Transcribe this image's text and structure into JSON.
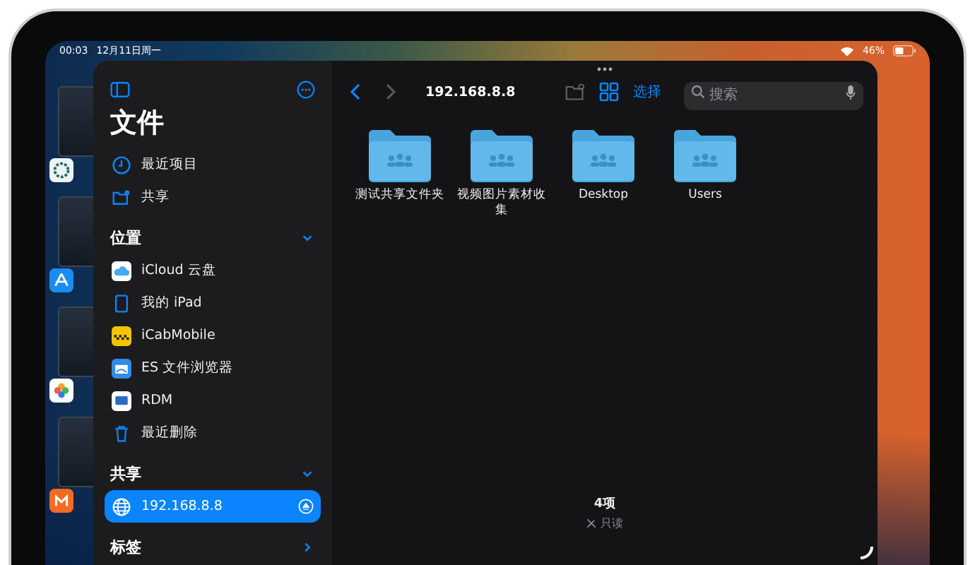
{
  "status_bar": {
    "time": "00:03",
    "date": "12月11日周一",
    "battery": "46%"
  },
  "sidebar": {
    "title": "文件",
    "items": [
      {
        "label": "最近项目",
        "kind": "clock",
        "selected": false
      },
      {
        "label": "共享",
        "kind": "shared",
        "selected": false
      }
    ],
    "sections": [
      {
        "title": "位置",
        "expanded": true,
        "items": [
          {
            "label": "iCloud 云盘",
            "kind": "cloud",
            "selected": false
          },
          {
            "label": "我的 iPad",
            "kind": "device",
            "selected": false
          },
          {
            "label": "iCabMobile",
            "kind": "cab",
            "selected": false
          },
          {
            "label": "ES 文件浏览器",
            "kind": "es",
            "selected": false
          },
          {
            "label": "RDM",
            "kind": "rdm",
            "selected": false
          },
          {
            "label": "最近删除",
            "kind": "trash",
            "selected": false
          }
        ]
      },
      {
        "title": "共享",
        "expanded": true,
        "items": [
          {
            "label": "192.168.8.8",
            "kind": "server",
            "selected": true
          }
        ]
      },
      {
        "title": "标签",
        "expanded": false
      }
    ]
  },
  "toolbar": {
    "path": "192.168.8.8",
    "select": "选择",
    "search": {
      "placeholder": "搜索"
    }
  },
  "folders": [
    {
      "name": "测试共享文件夹"
    },
    {
      "name": "视频图片素材收集"
    },
    {
      "name": "Desktop"
    },
    {
      "name": "Users"
    }
  ],
  "footer": {
    "count": "4项",
    "status": "只读"
  }
}
